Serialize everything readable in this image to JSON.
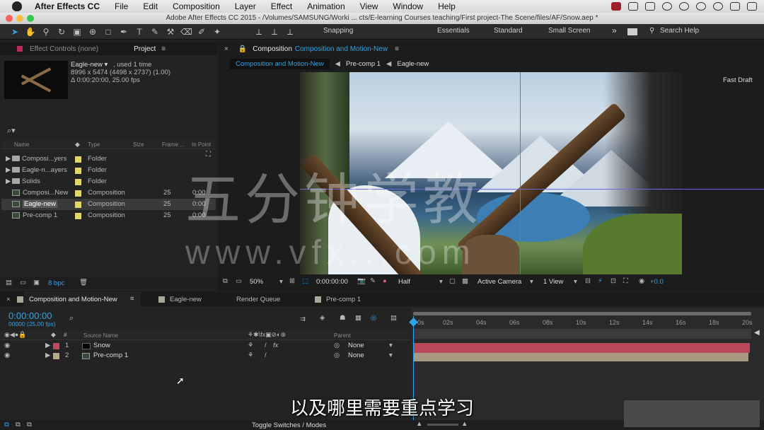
{
  "menubar": {
    "app": "After Effects CC",
    "items": [
      "File",
      "Edit",
      "Composition",
      "Layer",
      "Effect",
      "Animation",
      "View",
      "Window",
      "Help"
    ]
  },
  "titlebar": {
    "title": "Adobe After Effects CC 2015 - /Volumes/SAMSUNG/Worki ... cts/E-learning Courses teaching/First project-The Scene/files/AF/Snow.aep *"
  },
  "toolbar": {
    "snapping": "Snapping",
    "workspaces": [
      "Essentials",
      "Standard",
      "Small Screen"
    ],
    "search": "Search Help",
    "more": "»"
  },
  "project": {
    "tabs": {
      "effect_controls": "Effect Controls (none)",
      "project": "Project"
    },
    "preview": {
      "name": "Eagle-new ▾",
      "used": ", used 1 time",
      "dims": "8996 x 5474  (4498 x 2737) (1.00)",
      "duration": "Δ 0:00:20:00, 25.00 fps"
    },
    "search_icon": "⌕▾",
    "columns": {
      "name": "Name",
      "type": "Type",
      "size": "Size",
      "frame": "Frame ...",
      "inpoint": "In Point"
    },
    "rows": [
      {
        "name": "Composi...yers",
        "type": "Folder",
        "frame": "",
        "kind": "folder",
        "color": "#e0d86a"
      },
      {
        "name": "Eagle-n...ayers",
        "type": "Folder",
        "frame": "",
        "kind": "folder",
        "color": "#e0d86a"
      },
      {
        "name": "Solids",
        "type": "Folder",
        "frame": "",
        "kind": "folder",
        "color": "#e0d86a"
      },
      {
        "name": "Composi...New",
        "type": "Composition",
        "frame": "25",
        "inpoint": "0:00",
        "kind": "comp",
        "color": "#e0d86a"
      },
      {
        "name": "Eagle-new",
        "type": "Composition",
        "frame": "25",
        "inpoint": "0:00",
        "kind": "comp",
        "color": "#e0d86a"
      },
      {
        "name": "Pre-comp 1",
        "type": "Composition",
        "frame": "25",
        "inpoint": "0:00",
        "kind": "comp",
        "color": "#e0d86a"
      }
    ],
    "bpc": "8 bpc"
  },
  "viewer": {
    "tab_prefix": "Composition",
    "tab_name": "Composition and Motion-New",
    "breadcrumbs": [
      "Composition and Motion-New",
      "Pre-comp 1",
      "Eagle-new"
    ],
    "fast_draft": "Fast Draft",
    "zoom": "50%",
    "timecode": "0:00:00:00",
    "resolution": "Half",
    "camera": "Active Camera",
    "views": "1 View",
    "exposure": "+0.0"
  },
  "timeline": {
    "tabs": [
      "Composition and Motion-New",
      "Eagle-new",
      "Render Queue",
      "Pre-comp 1"
    ],
    "timecode": "0:00:00:00",
    "frames": "00000 (25.00 fps)",
    "columns": {
      "source": "Source Name",
      "parent": "Parent"
    },
    "layers": [
      {
        "num": "1",
        "name": "Snow",
        "parent": "None",
        "color": "#c0485a"
      },
      {
        "num": "2",
        "name": "Pre-comp 1",
        "parent": "None",
        "color": "#b8a88a"
      }
    ],
    "ticks": [
      "0s",
      "02s",
      "04s",
      "06s",
      "08s",
      "10s",
      "12s",
      "14s",
      "16s",
      "18s",
      "20s"
    ],
    "toggle": "Toggle Switches / Modes"
  },
  "overlay": {
    "subtitle": "以及哪里需要重点学习",
    "watermark": "五分钟学教",
    "watermark_url": "www.vfx...com"
  }
}
